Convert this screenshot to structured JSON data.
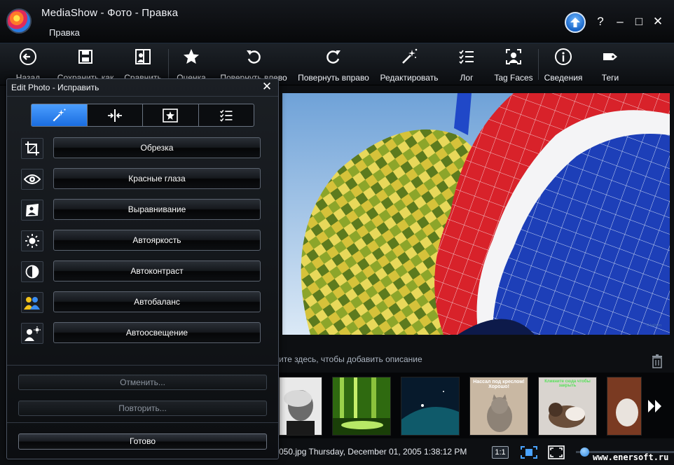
{
  "window": {
    "title": "MediaShow - Фото - Правка",
    "subtitle": "Правка",
    "controls": {
      "help": "?",
      "minimize": "–",
      "maximize": "□",
      "close": "✕"
    }
  },
  "toolbar": {
    "items": [
      {
        "label": "Назад",
        "icon": "back-arrow-icon"
      },
      {
        "label": "Сохранить как",
        "icon": "save-as-icon"
      },
      {
        "label": "Сравнить",
        "icon": "compare-icon"
      },
      {
        "label": "Оценка",
        "icon": "star-icon"
      },
      {
        "label": "Повернуть влево",
        "icon": "rotate-left-icon"
      },
      {
        "label": "Повернуть вправо",
        "icon": "rotate-right-icon"
      },
      {
        "label": "Редактировать",
        "icon": "magic-wand-icon"
      },
      {
        "label": "Лог",
        "icon": "checklist-icon"
      },
      {
        "label": "Tag Faces",
        "icon": "face-tag-icon"
      },
      {
        "label": "Сведения",
        "icon": "info-icon"
      },
      {
        "label": "Теги",
        "icon": "tag-icon"
      }
    ]
  },
  "dialog": {
    "title": "Edit Photo - Исправить",
    "close": "✕",
    "tabs": [
      {
        "icon": "magic-wand-icon",
        "active": true
      },
      {
        "icon": "adjust-icon",
        "active": false
      },
      {
        "icon": "effects-icon",
        "active": false
      },
      {
        "icon": "checklist-icon",
        "active": false
      }
    ],
    "tools": [
      {
        "label": "Обрезка",
        "icon": "crop-icon"
      },
      {
        "label": "Красные глаза",
        "icon": "eye-icon"
      },
      {
        "label": "Выравнивание",
        "icon": "straighten-icon"
      },
      {
        "label": "Автояркость",
        "icon": "brightness-icon"
      },
      {
        "label": "Автоконтраст",
        "icon": "contrast-icon"
      },
      {
        "label": "Автобаланс",
        "icon": "color-balance-icon"
      },
      {
        "label": "Автоосвещение",
        "icon": "lighting-icon"
      }
    ],
    "undo": "Отменить...",
    "redo": "Повторить...",
    "done": "Готово"
  },
  "viewer": {
    "description_hint": "ите здесь, чтобы добавить описание",
    "thumb_captions": [
      "Нассал под креслом! Хорошо!",
      "Кликните сюда чтобы закрыть"
    ],
    "status_text": "050.jpg  Thursday, December 01, 2005 1:38:12 PM",
    "ratio_label": "1:1",
    "zoom_level": 0.05
  },
  "watermark": "www.enersoft.ru",
  "colors": {
    "accent": "#1a6de0",
    "background": "#0d0f12",
    "dialog_border": "#4a5260"
  }
}
